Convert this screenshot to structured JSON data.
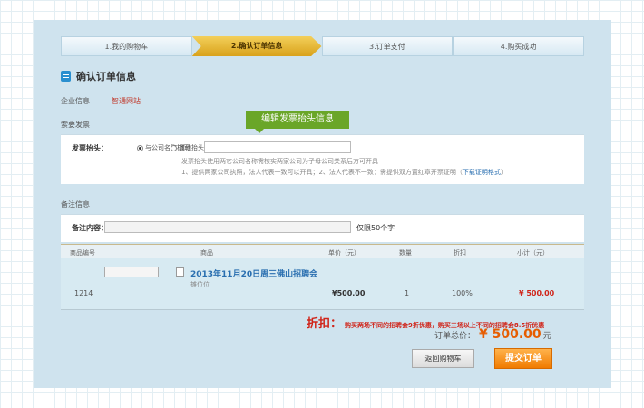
{
  "steps": [
    {
      "label": "1.我的购物车"
    },
    {
      "label": "2.确认订单信息"
    },
    {
      "label": "3.订单支付"
    },
    {
      "label": "4.购买成功"
    }
  ],
  "page_title": "确认订单信息",
  "company": {
    "label": "企业信息",
    "name": "智通网站"
  },
  "invoice": {
    "section_label": "索要发票",
    "tooltip": "编辑发票抬头信息",
    "field_label": "发票抬头：",
    "option_company": "与公司名称相同",
    "option_other": "其他抬头",
    "hint1": "发票抬头使用两它公司名称需核实两家公司为子母公司关系后方可开具",
    "hint2": "1、提供两家公司执照，法人代表一致可以开具；2、法人代表不一致：需提供双方置红章开票证明（",
    "hint2_link": "下载证明格式",
    "hint2_end": "）"
  },
  "remark": {
    "section_label": "备注信息",
    "field_label": "备注内容：",
    "limit_text": "仅限50个字"
  },
  "table": {
    "headers": [
      "商品编号",
      "商品",
      "单价（元）",
      "数量",
      "折扣",
      "小计（元）"
    ],
    "row": {
      "id": "1214",
      "product_name": "2013年11月20日周三佛山招聘会",
      "product_sub": "摊位位",
      "unit_price": "¥500.00",
      "quantity": "1",
      "discount": "100%",
      "subtotal": "¥ 500.00"
    }
  },
  "discount_info": {
    "title": "折扣：",
    "text": "购买两场不同的招聘会9折优惠，购买三场以上不同的招聘会8.5折优惠"
  },
  "total": {
    "label": "订单总价：",
    "amount": "¥ 500.00",
    "unit": "元"
  },
  "buttons": {
    "back": "返回购物车",
    "submit": "提交订单"
  },
  "colors": {
    "accent_red": "#d0251a",
    "submit_orange": "#f07b00",
    "tip_green": "#6aa628",
    "panel_blue": "#cfe3ee"
  }
}
